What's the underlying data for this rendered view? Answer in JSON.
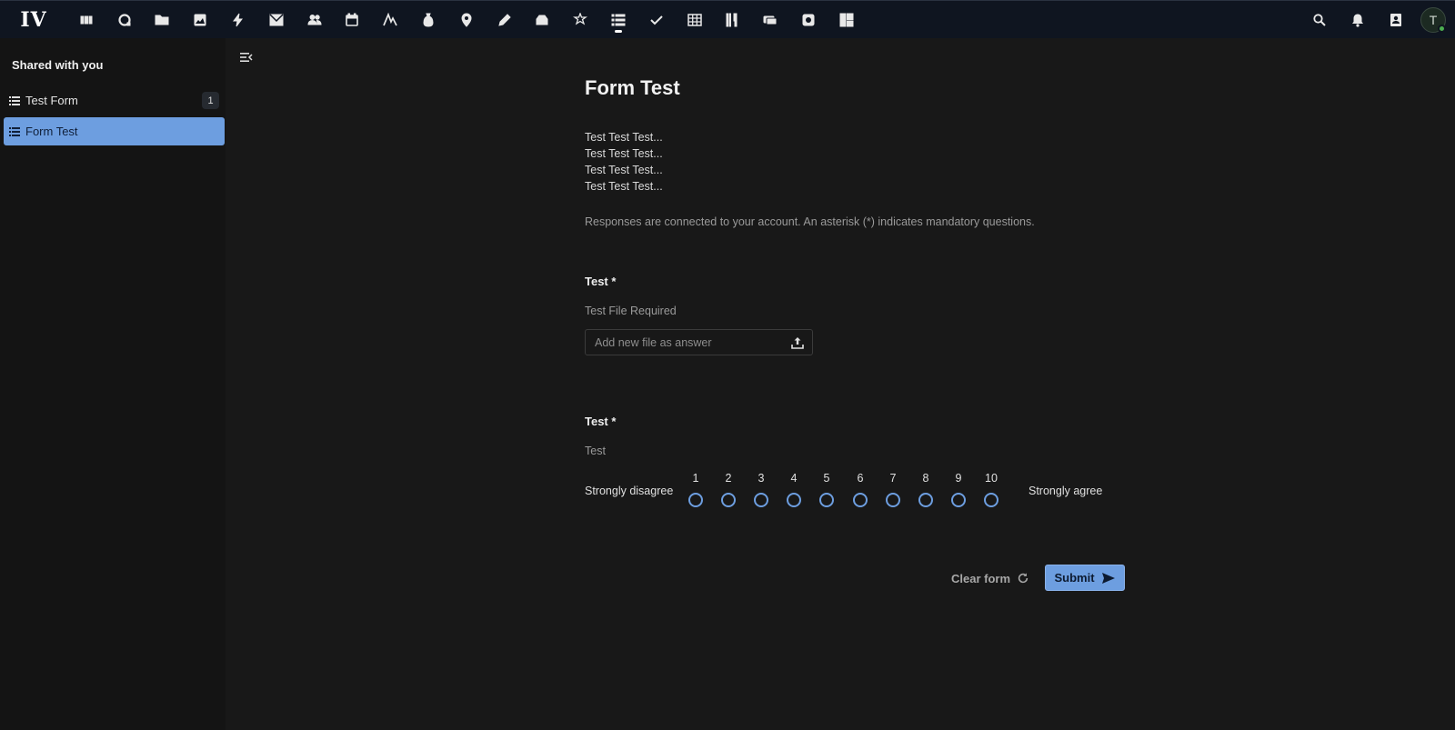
{
  "topbar": {
    "logo": "IV",
    "apps": [
      {
        "name": "dashboard-app-icon"
      },
      {
        "name": "circles-app-icon"
      },
      {
        "name": "files-app-icon"
      },
      {
        "name": "photos-app-icon"
      },
      {
        "name": "activity-app-icon"
      },
      {
        "name": "mail-app-icon"
      },
      {
        "name": "contacts-app-icon"
      },
      {
        "name": "calendar-app-icon"
      },
      {
        "name": "notes-app-icon"
      },
      {
        "name": "money-app-icon"
      },
      {
        "name": "maps-app-icon"
      },
      {
        "name": "edit-app-icon"
      },
      {
        "name": "stack-app-icon"
      },
      {
        "name": "magic-app-icon"
      },
      {
        "name": "forms-app-icon",
        "active": true
      },
      {
        "name": "tasks-app-icon"
      },
      {
        "name": "tables-app-icon"
      },
      {
        "name": "cookbook-app-icon"
      },
      {
        "name": "cospend-app-icon"
      },
      {
        "name": "camera-app-icon"
      },
      {
        "name": "deck-app-icon"
      }
    ],
    "avatar_initial": "T"
  },
  "sidebar": {
    "heading": "Shared with you",
    "items": [
      {
        "label": "Test Form",
        "badge": "1",
        "active": false
      },
      {
        "label": "Form Test",
        "badge": "",
        "active": true
      }
    ]
  },
  "form": {
    "title": "Form Test",
    "description_lines": [
      "Test Test Test...",
      "Test Test Test...",
      "Test Test Test...",
      "Test Test Test..."
    ],
    "note": "Responses are connected to your account. An asterisk (*) indicates mandatory questions.",
    "questions": [
      {
        "title": "Test *",
        "subtitle": "Test File Required",
        "placeholder": "Add new file as answer"
      },
      {
        "title": "Test *",
        "subtitle": "Test",
        "low_label": "Strongly disagree",
        "high_label": "Strongly agree",
        "options": [
          "1",
          "2",
          "3",
          "4",
          "5",
          "6",
          "7",
          "8",
          "9",
          "10"
        ]
      }
    ],
    "clear_label": "Clear form",
    "submit_label": "Submit"
  },
  "colors": {
    "accent": "#6d9ee0",
    "background": "#181818",
    "topbar": "#0f1520"
  }
}
